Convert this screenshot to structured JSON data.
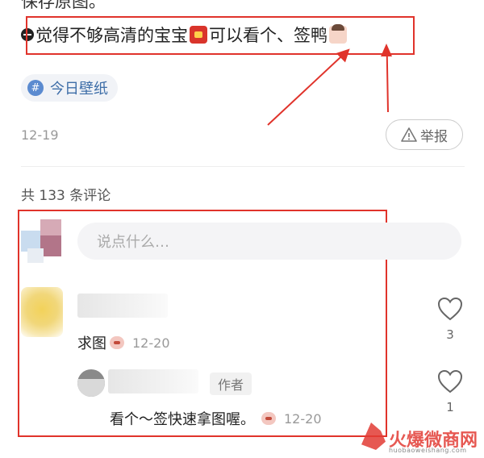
{
  "post": {
    "prev_line": "保存原图。",
    "text_before": "觉得不够高清的宝宝",
    "text_middle": "可以看个、签鸭",
    "tag": "今日壁纸",
    "date": "12-19",
    "report_label": "举报"
  },
  "comments": {
    "count_label": "共 133 条评论",
    "input_placeholder": "说点什么…",
    "items": [
      {
        "text": "求图",
        "date": "12-20",
        "likes": "3"
      }
    ],
    "reply": {
      "author_tag": "作者",
      "text": "看个～签快速拿图喔。",
      "date": "12-20",
      "likes": "1"
    }
  },
  "watermark": {
    "brand": "火爆微商网",
    "domain": "huobaoweishang.com"
  },
  "colors": {
    "annotation": "#e0332b",
    "tag_text": "#3e6ea8",
    "muted": "#999999"
  },
  "icons": [
    "info-circle-icon",
    "emoji-red-envelope-icon",
    "emoji-girl-icon",
    "hashtag-icon",
    "warning-triangle-icon",
    "heart-icon",
    "emoji-face-icon"
  ]
}
